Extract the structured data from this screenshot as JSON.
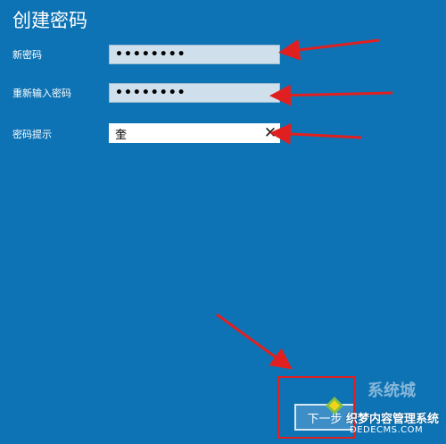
{
  "dialog": {
    "title": "创建密码",
    "new_password": {
      "label": "新密码",
      "value": "••••••••"
    },
    "confirm_password": {
      "label": "重新输入密码",
      "value": "••••••••"
    },
    "password_hint": {
      "label": "密码提示",
      "value": "奎"
    },
    "clear_icon": "✕",
    "next_button_label": "下一步"
  },
  "watermark": {
    "brand": "系统城",
    "title": "织梦内容管理系统",
    "url": "DEDECMS.COM"
  },
  "colors": {
    "background": "#0e73b4",
    "annotation_red": "#e02020",
    "field_fill": "#cfe0ec"
  }
}
